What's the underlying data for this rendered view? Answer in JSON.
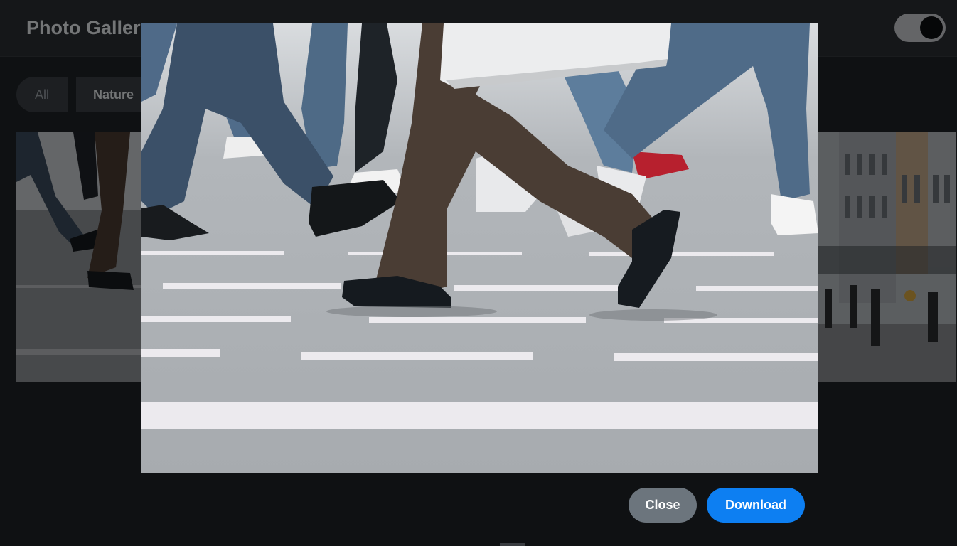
{
  "app": {
    "title": "Photo Gallery"
  },
  "filters": [
    {
      "label": "All"
    },
    {
      "label": "Nature"
    }
  ],
  "lightbox": {
    "close_label": "Close",
    "download_label": "Download"
  },
  "colors": {
    "download_button": "#0d7ff2",
    "close_button": "#6c757d",
    "page_background": "#1f2226"
  },
  "icons": {
    "theme_toggle": "toggle-switch-icon"
  }
}
